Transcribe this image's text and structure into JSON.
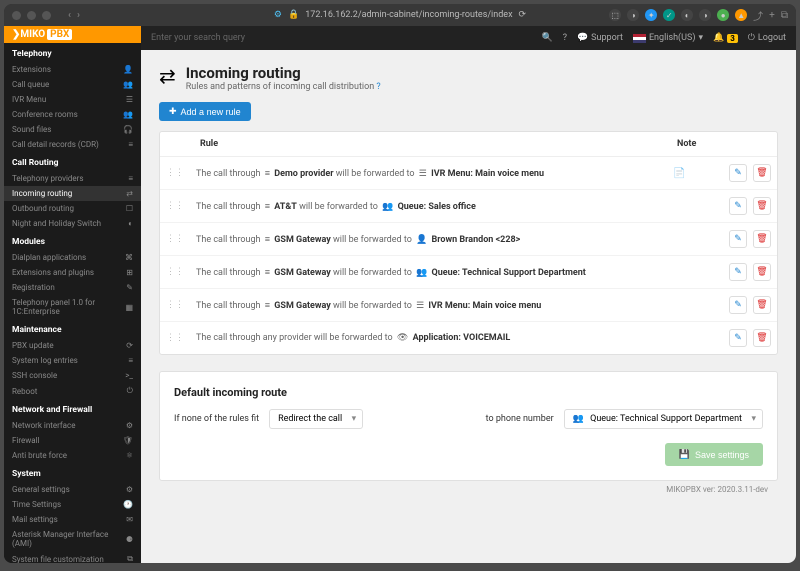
{
  "window": {
    "url": "172.16.162.2/admin-cabinet/incoming-routes/index"
  },
  "brand": {
    "prefix": "MIKO",
    "suffix": "PBX"
  },
  "topbar": {
    "search_placeholder": "Enter your search query",
    "support": "Support",
    "language": "English(US)",
    "notif_count": "3",
    "logout": "Logout"
  },
  "sidebar": {
    "groups": [
      {
        "title": "Telephony",
        "items": [
          {
            "label": "Extensions",
            "icon": "👤"
          },
          {
            "label": "Call queue",
            "icon": "👥"
          },
          {
            "label": "IVR Menu",
            "icon": "☰"
          },
          {
            "label": "Conference rooms",
            "icon": "👥"
          },
          {
            "label": "Sound files",
            "icon": "🎧"
          },
          {
            "label": "Call detail records (CDR)",
            "icon": "≡"
          }
        ]
      },
      {
        "title": "Call Routing",
        "items": [
          {
            "label": "Telephony providers",
            "icon": "≡"
          },
          {
            "label": "Incoming routing",
            "icon": "⇄",
            "active": true
          },
          {
            "label": "Outbound routing",
            "icon": "☐"
          },
          {
            "label": "Night and Holiday Switch",
            "icon": "◐"
          }
        ]
      },
      {
        "title": "Modules",
        "items": [
          {
            "label": "Dialplan applications",
            "icon": "⌘"
          },
          {
            "label": "Extensions and plugins",
            "icon": "⊞"
          },
          {
            "label": "Registration",
            "icon": "✎"
          },
          {
            "label": "Telephony panel 1.0 for 1C:Enterprise",
            "icon": "▦"
          }
        ]
      },
      {
        "title": "Maintenance",
        "items": [
          {
            "label": "PBX update",
            "icon": "⟳"
          },
          {
            "label": "System log entries",
            "icon": "≡"
          },
          {
            "label": "SSH console",
            "icon": ">_"
          },
          {
            "label": "Reboot",
            "icon": "⏻"
          }
        ]
      },
      {
        "title": "Network and Firewall",
        "items": [
          {
            "label": "Network interface",
            "icon": "⚙"
          },
          {
            "label": "Firewall",
            "icon": "🛡"
          },
          {
            "label": "Anti brute force",
            "icon": "⚛"
          }
        ]
      },
      {
        "title": "System",
        "items": [
          {
            "label": "General settings",
            "icon": "⚙"
          },
          {
            "label": "Time Settings",
            "icon": "🕐"
          },
          {
            "label": "Mail settings",
            "icon": "✉"
          },
          {
            "label": "Asterisk Manager Interface (AMI)",
            "icon": "⚈"
          },
          {
            "label": "System file customization",
            "icon": "⧉"
          }
        ]
      }
    ]
  },
  "page": {
    "title": "Incoming routing",
    "subtitle": "Rules and patterns of incoming call distribution",
    "add_button": "Add a new rule",
    "headers": {
      "rule": "Rule",
      "note": "Note"
    },
    "rules": [
      {
        "prefix": "The call through",
        "provider_icon": "≡",
        "provider": "Demo provider",
        "mid": "will be forwarded to",
        "target_icon": "☰",
        "target": "IVR Menu: Main voice menu",
        "has_note": true
      },
      {
        "prefix": "The call through",
        "provider_icon": "≡",
        "provider": "AT&T",
        "mid": "will be forwarded to",
        "target_icon": "👥",
        "target": "Queue: Sales office",
        "has_note": false
      },
      {
        "prefix": "The call through",
        "provider_icon": "≡",
        "provider": "GSM Gateway",
        "mid": "will be forwarded to",
        "target_icon": "👤",
        "target": "Brown Brandon <228>",
        "has_note": false
      },
      {
        "prefix": "The call through",
        "provider_icon": "≡",
        "provider": "GSM Gateway",
        "mid": "will be forwarded to",
        "target_icon": "👥",
        "target": "Queue: Technical Support Department",
        "has_note": false
      },
      {
        "prefix": "The call through",
        "provider_icon": "≡",
        "provider": "GSM Gateway",
        "mid": "will be forwarded to",
        "target_icon": "☰",
        "target": "IVR Menu: Main voice menu",
        "has_note": false
      },
      {
        "prefix": "The call through any provider will be forwarded to",
        "provider_icon": "",
        "provider": "",
        "mid": "",
        "target_icon": "👁",
        "target": "Application: VOICEMAIL",
        "has_note": false
      }
    ],
    "default": {
      "title": "Default incoming route",
      "label_rules": "If none of the rules fit",
      "action": "Redirect the call",
      "label_phone": "to phone number",
      "phone_value": "Queue: Technical Support Department",
      "save": "Save settings"
    }
  },
  "footer": {
    "version": "MIKOPBX ver: 2020.3.11-dev"
  }
}
